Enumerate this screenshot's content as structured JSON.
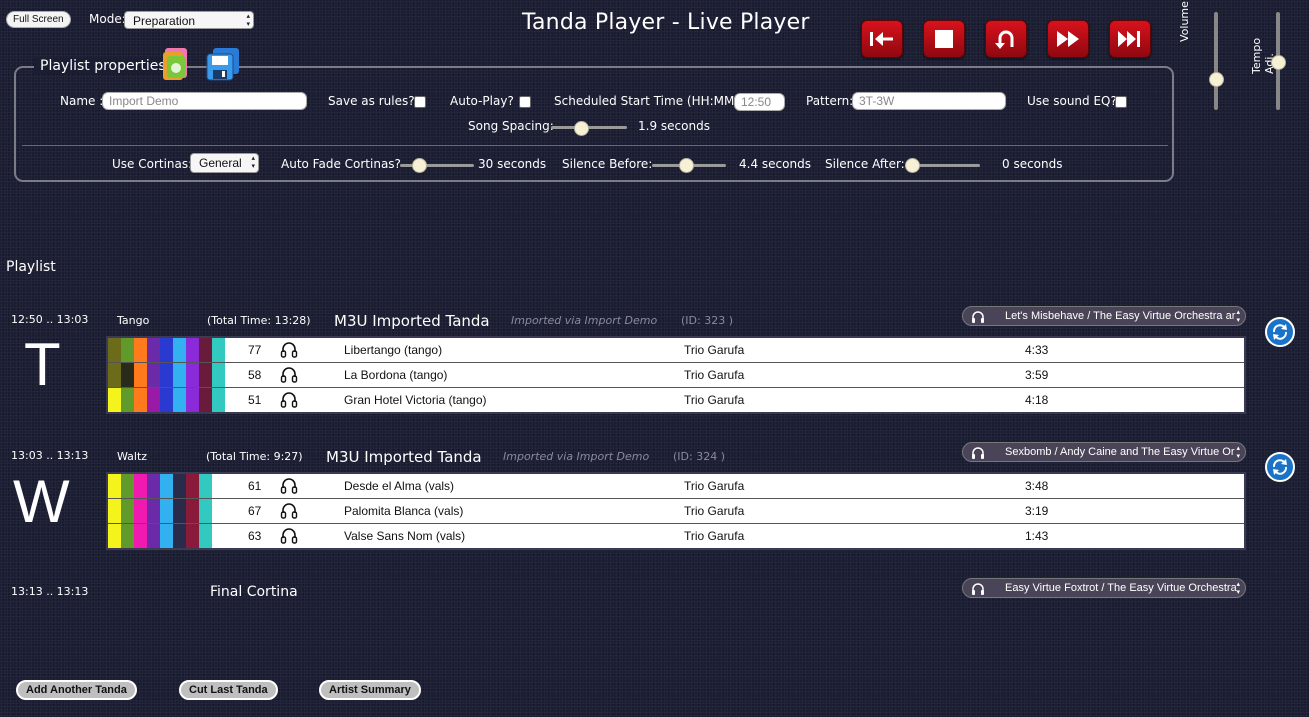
{
  "header": {
    "full_screen_label": "Full Screen",
    "mode_label": "Mode:",
    "mode_value": "Preparation",
    "title": "Tanda Player - Live Player",
    "volume_label": "Volume",
    "tempo_label": "Tempo Adj.",
    "volume_level": 0.3,
    "tempo_level": 0.5
  },
  "controls": [
    {
      "name": "skip-to-start",
      "icon": "skip-to-start-icon"
    },
    {
      "name": "stop",
      "icon": "stop-icon"
    },
    {
      "name": "rewind",
      "icon": "undo-icon"
    },
    {
      "name": "fast-forward",
      "icon": "fast-forward-icon"
    },
    {
      "name": "skip-next",
      "icon": "skip-next-icon"
    }
  ],
  "properties": {
    "legend": "Playlist properties",
    "name_label": "Name :",
    "name_value": "Import Demo",
    "save_rules_label": "Save as rules? :",
    "autoplay_label": "Auto-Play? :",
    "start_time_label": "Scheduled Start Time (HH:MM) :",
    "start_time_value": "12:50",
    "pattern_label": "Pattern:",
    "pattern_value": "3T-3W",
    "sound_eq_label": "Use sound EQ?",
    "song_spacing_label": "Song Spacing:",
    "song_spacing_value": "1.9 seconds",
    "cortinas_label": "Use Cortinas:",
    "cortinas_value": "General",
    "auto_fade_label": "Auto Fade Cortinas?",
    "auto_fade_value": "30 seconds",
    "silence_before_label": "Silence Before:",
    "silence_before_value": "4.4 seconds",
    "silence_after_label": "Silence After:",
    "silence_after_value": "0 seconds"
  },
  "playlist_heading": "Playlist",
  "tandas": [
    {
      "time": "12:50 .. 13:03",
      "letter": "T",
      "style": "Tango",
      "total_time": "(Total Time: 13:28)",
      "name": "M3U Imported Tanda",
      "imported": "Imported via Import Demo",
      "id": "(ID: 323 )",
      "cortina": "Let's Misbehave / The Easy Virtue Orchestra ar",
      "songs": [
        {
          "num": "77",
          "title": "Libertango (tango)",
          "artist": "Trio Garufa",
          "duration": "4:33",
          "colors": [
            "#6b6b1a",
            "#5f9a2a",
            "#ff7a1c",
            "#6b2aa8",
            "#2a3ad0",
            "#32b0f0",
            "#8a2ad8",
            "#6a1a3a",
            "#31c9c0"
          ]
        },
        {
          "num": "58",
          "title": "La Bordona (tango)",
          "artist": "Trio Garufa",
          "duration": "3:59",
          "colors": [
            "#6b6b1a",
            "#2a2a1a",
            "#ff7a1c",
            "#6b2aa8",
            "#2a3ad0",
            "#32b0f0",
            "#8a2ad8",
            "#6a1a3a",
            "#31c9c0"
          ]
        },
        {
          "num": "51",
          "title": "Gran Hotel Victoria (tango)",
          "artist": "Trio Garufa",
          "duration": "4:18",
          "colors": [
            "#f4f41c",
            "#5f9a2a",
            "#ff7a1c",
            "#9a1aa8",
            "#2a3ad0",
            "#32b0f0",
            "#8a2ad8",
            "#6a1a3a",
            "#31c9c0"
          ]
        }
      ]
    },
    {
      "time": "13:03 .. 13:13",
      "letter": "W",
      "style": "Waltz",
      "total_time": "(Total Time: 9:27)",
      "name": "M3U Imported Tanda",
      "imported": "Imported via Import Demo",
      "id": "(ID: 324 )",
      "cortina": "Sexbomb / Andy Caine and The Easy Virtue Or",
      "songs": [
        {
          "num": "61",
          "title": "Desde el Alma (vals)",
          "artist": "Trio Garufa",
          "duration": "3:48",
          "colors": [
            "#f4f41c",
            "#5f9a2a",
            "#f01ab0",
            "#6b2aa8",
            "#32b0f0",
            "#2a2a4a",
            "#8a1a3a",
            "#31c9c0"
          ]
        },
        {
          "num": "67",
          "title": "Palomita Blanca (vals)",
          "artist": "Trio Garufa",
          "duration": "3:19",
          "colors": [
            "#f4f41c",
            "#5f9a2a",
            "#f01ab0",
            "#6b2aa8",
            "#32b0f0",
            "#2a2a4a",
            "#8a1a3a",
            "#31c9c0"
          ]
        },
        {
          "num": "63",
          "title": "Valse Sans Nom (vals)",
          "artist": "Trio Garufa",
          "duration": "1:43",
          "colors": [
            "#f4f41c",
            "#5f9a2a",
            "#f01ab0",
            "#6b2aa8",
            "#32b0f0",
            "#2a2a4a",
            "#8a1a3a",
            "#31c9c0"
          ]
        }
      ]
    }
  ],
  "final": {
    "time": "13:13 .. 13:13",
    "label": "Final Cortina",
    "cortina": "Easy Virtue Foxtrot / The Easy Virtue Orchestra"
  },
  "bottom_buttons": {
    "add": "Add Another Tanda",
    "cut": "Cut Last Tanda",
    "artist": "Artist Summary"
  }
}
